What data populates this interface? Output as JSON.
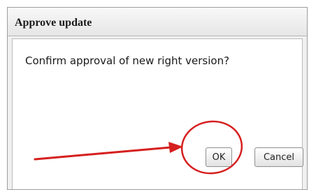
{
  "dialog": {
    "title": "Approve update",
    "message": "Confirm approval of new right version?"
  },
  "buttons": {
    "ok_label": "OK",
    "cancel_label": "Cancel"
  },
  "annotation": {
    "color": "#d61f1f"
  }
}
